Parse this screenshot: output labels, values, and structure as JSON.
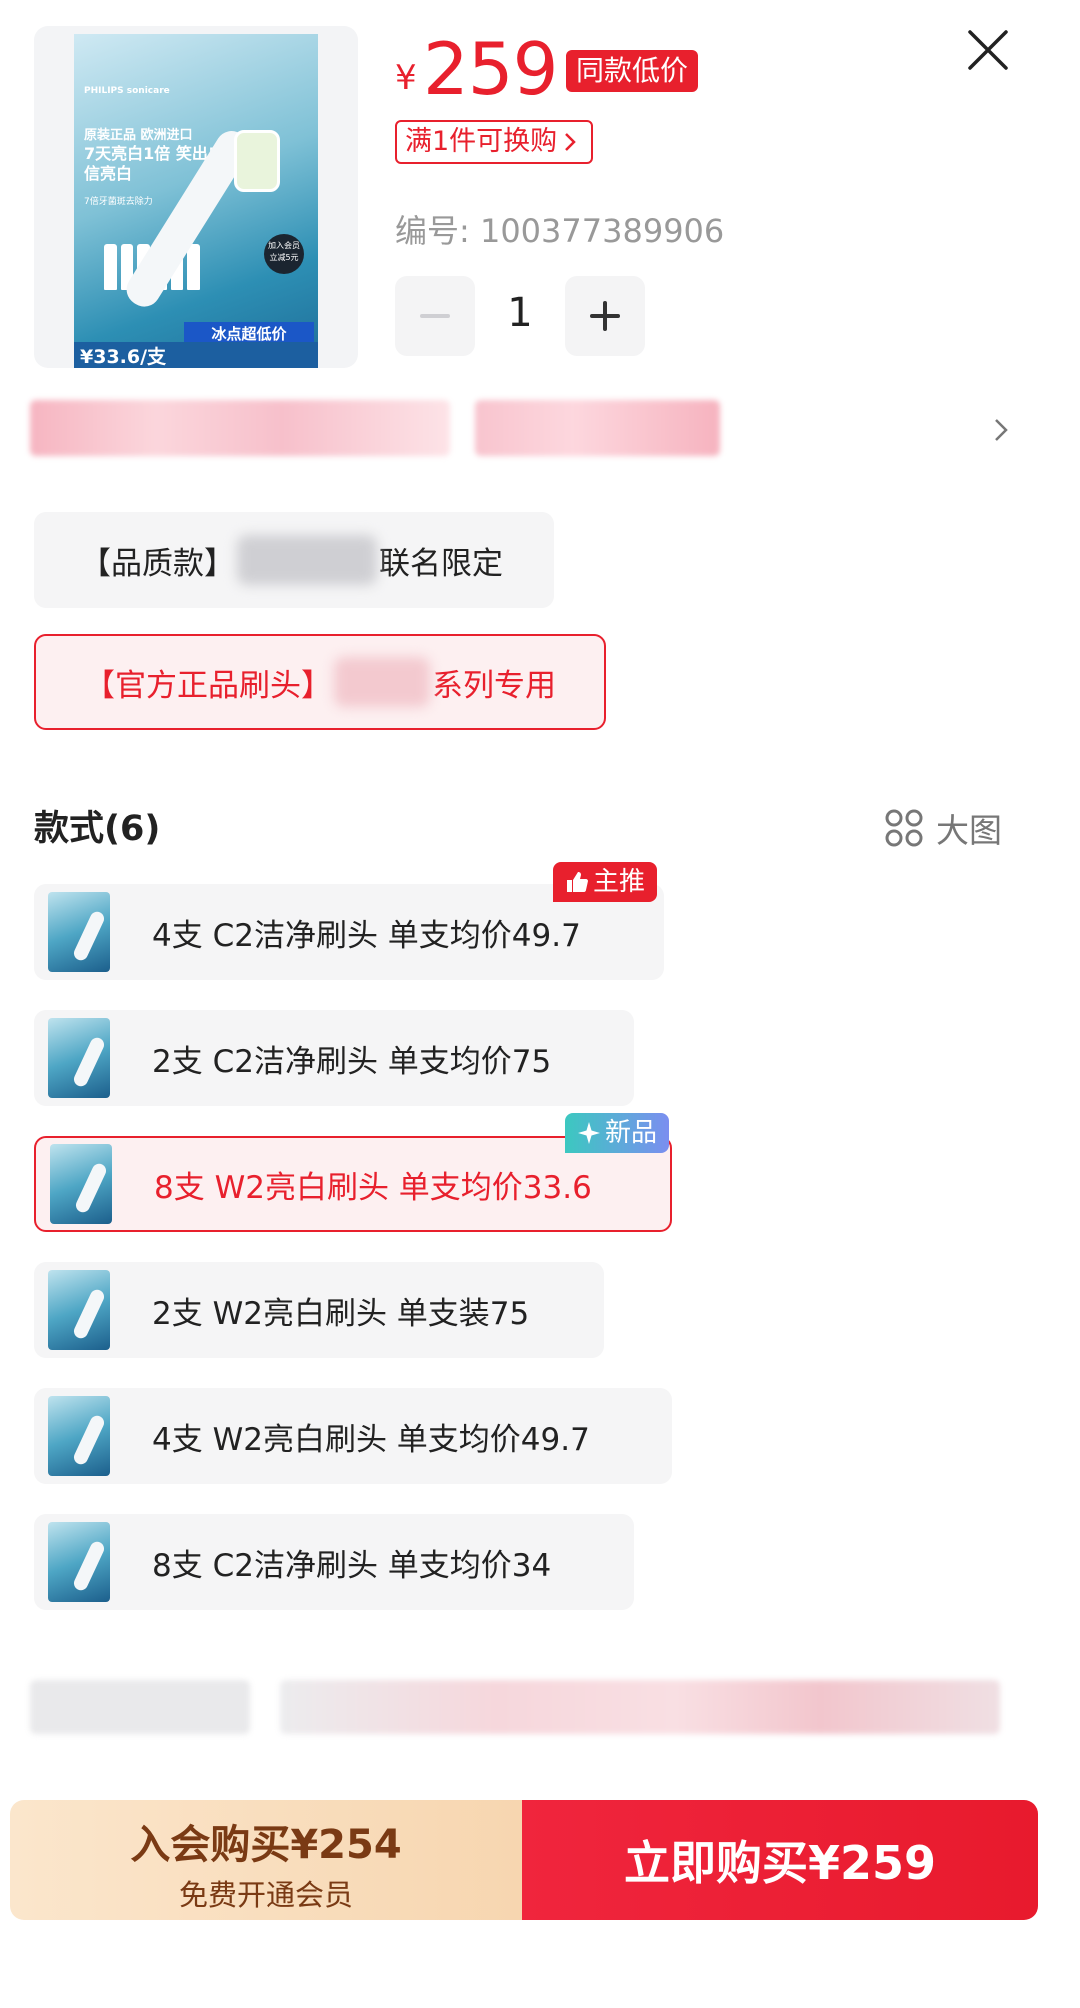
{
  "product": {
    "image_text": {
      "brand": "PHILIPS sonicare",
      "line1": "原装正品 欧洲进口",
      "line2": "7天亮白1倍 笑出自信亮白",
      "line3": "7倍牙菌斑去除力",
      "badge": "加入会员 立减5元",
      "promo": "冰点超低价",
      "price": "¥33.6/支"
    },
    "currency": "¥",
    "price": "259",
    "lowest_tag": "同款低价",
    "swap_tag": "满1件可换购",
    "sku_code": "编号: 100377389906"
  },
  "quantity": {
    "value": "1",
    "minus": "−",
    "plus": "+"
  },
  "variants": {
    "quality_prefix": "【品质款】",
    "quality_suffix": "联名限定",
    "official_prefix": "【官方正品刷头】",
    "official_suffix": "系列专用"
  },
  "styles": {
    "title": "款式(6)",
    "grid_label": "大图",
    "items": [
      {
        "label": "4支 C2洁净刷头 单支均价49.7",
        "badge": "主推"
      },
      {
        "label": "2支 C2洁净刷头 单支均价75"
      },
      {
        "label": "8支 W2亮白刷头 单支均价33.6",
        "badge": "新品",
        "selected": true
      },
      {
        "label": "2支 W2亮白刷头 单支装75"
      },
      {
        "label": "4支 W2亮白刷头 单支均价49.7"
      },
      {
        "label": "8支 C2洁净刷头 单支均价34"
      }
    ]
  },
  "actions": {
    "member_main": "入会购买¥254",
    "member_sub": "免费开通会员",
    "buy": "立即购买¥259"
  },
  "colors": {
    "accent": "#e8202d",
    "member_text": "#7a3a14"
  }
}
